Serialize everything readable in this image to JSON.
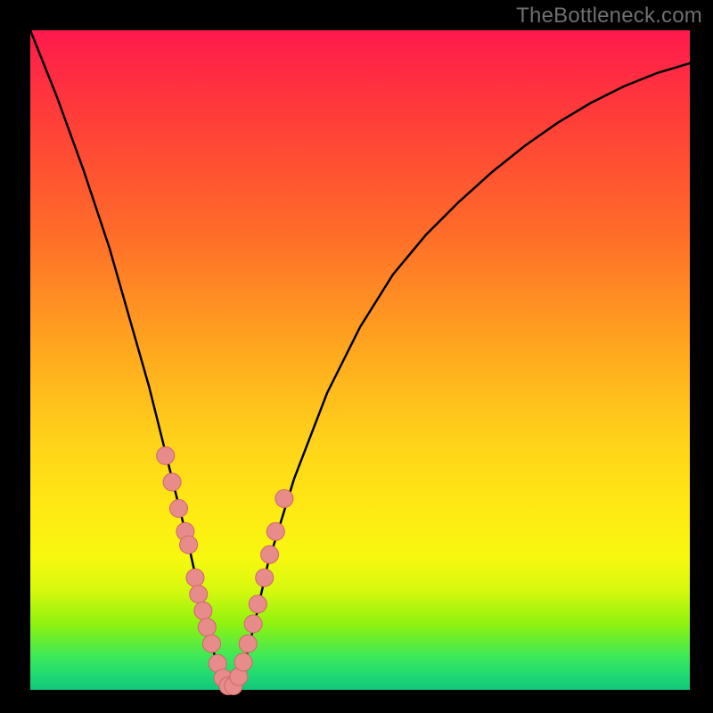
{
  "watermark": "TheBottleneck.com",
  "colors": {
    "background": "#000000",
    "curve_stroke": "#000000",
    "marker_fill": "#e78b8b",
    "marker_stroke": "#d06868"
  },
  "chart_data": {
    "type": "line",
    "title": "",
    "xlabel": "",
    "ylabel": "",
    "xlim": [
      0,
      100
    ],
    "ylim": [
      0,
      100
    ],
    "grid": false,
    "series": [
      {
        "name": "bottleneck-curve",
        "x": [
          0,
          4,
          8,
          12,
          16,
          18,
          20,
          22,
          24,
          26,
          27,
          28,
          29,
          30,
          31,
          32,
          33,
          34,
          36,
          40,
          45,
          50,
          55,
          60,
          65,
          70,
          75,
          80,
          85,
          90,
          95,
          100
        ],
        "y": [
          100,
          90,
          79,
          67,
          53,
          46,
          38,
          30,
          22,
          13,
          9,
          5,
          2,
          0.5,
          0.5,
          2,
          6,
          10,
          19,
          32,
          45,
          55,
          63,
          69,
          74,
          78.5,
          82.5,
          86,
          89,
          91.5,
          93.5,
          95
        ]
      }
    ],
    "markers": {
      "name": "highlighted-points",
      "x": [
        20.5,
        21.5,
        22.5,
        23.5,
        24,
        25,
        25.5,
        26.2,
        26.8,
        27.5,
        28.4,
        29.2,
        30,
        30.8,
        31.6,
        32.3,
        33,
        33.8,
        34.5,
        35.5,
        36.3,
        37.2,
        38.5
      ],
      "y": [
        35.5,
        31.5,
        27.5,
        24,
        22,
        17,
        14.5,
        12,
        9.5,
        7,
        4,
        1.8,
        0.6,
        0.6,
        2,
        4.2,
        7,
        10,
        13,
        17,
        20.5,
        24,
        29
      ]
    }
  }
}
